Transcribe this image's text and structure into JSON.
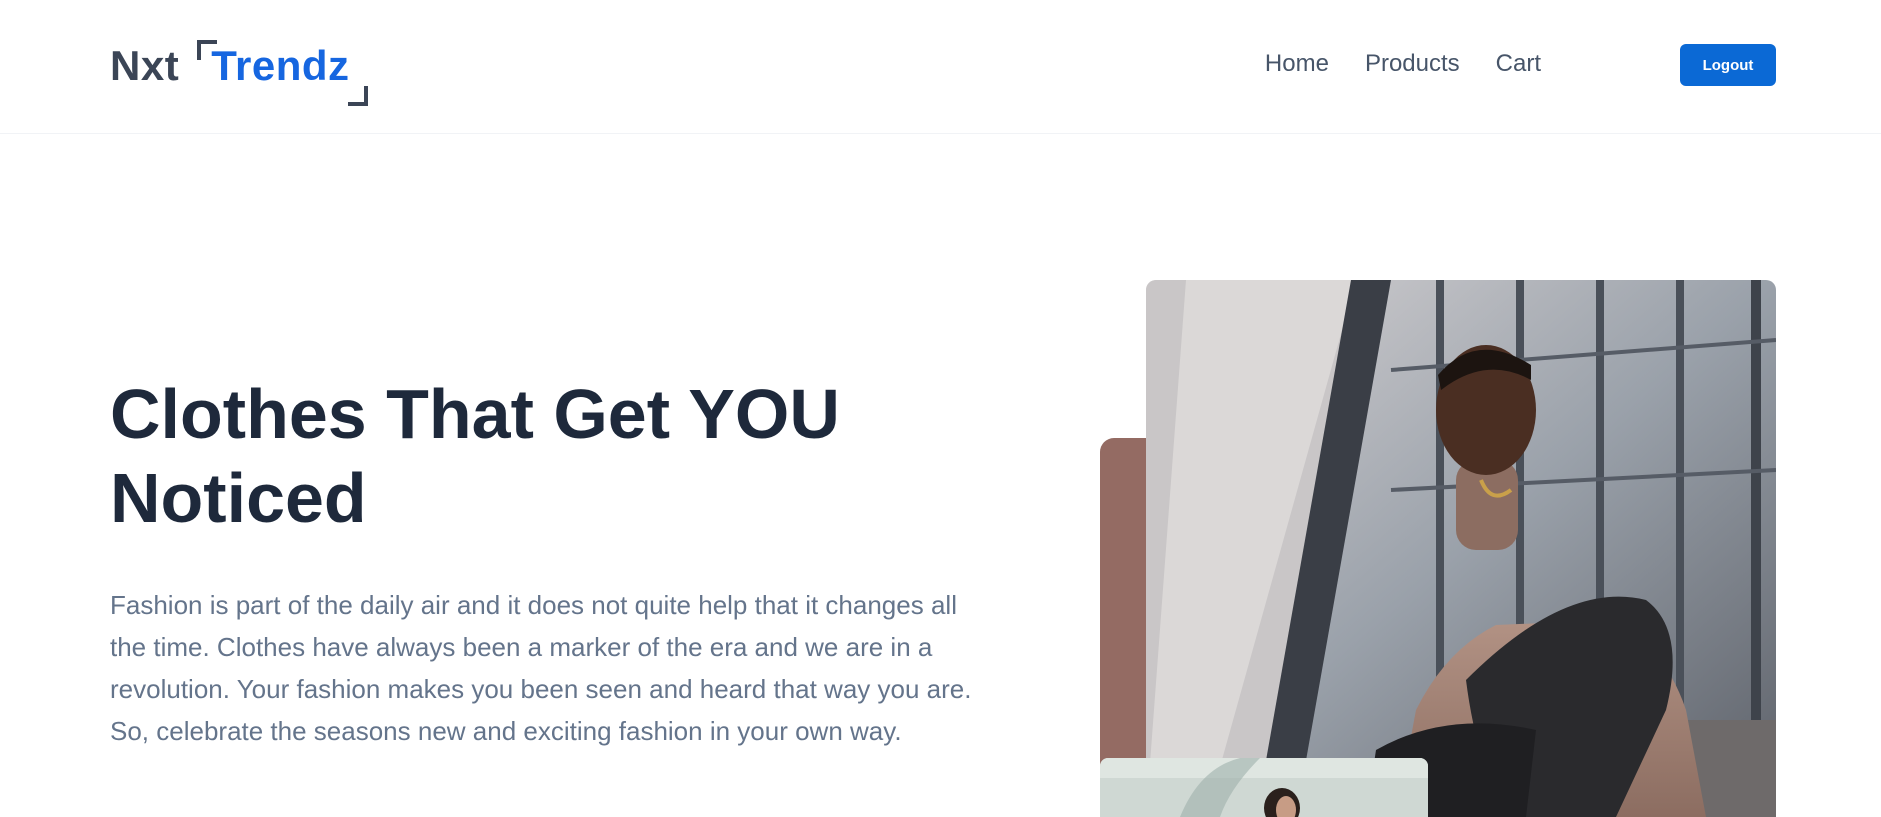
{
  "brand": {
    "part1": "Nxt",
    "part2": "Trendz",
    "accent_color": "#1666e0"
  },
  "nav": {
    "links": [
      "Home",
      "Products",
      "Cart"
    ],
    "logout_label": "Logout",
    "button_color": "#0b69d5"
  },
  "hero": {
    "heading": "Clothes That Get YOU Noticed",
    "description": "Fashion is part of the daily air and it does not quite help that it changes all the time. Clothes have always been a marker of the era and we are in a revolution. Your fashion makes you been seen and heard that way you are. So, celebrate the seasons new and exciting fashion in your own way."
  },
  "images": {
    "main": "man-in-turtleneck-sitting-on-steps-photo",
    "secondary": "woman-fashion-thumbnail-photo",
    "accent_color": "#946b63"
  }
}
